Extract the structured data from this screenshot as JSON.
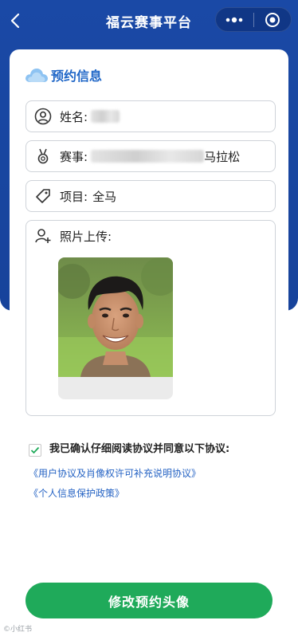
{
  "nav": {
    "title": "福云赛事平台"
  },
  "section": {
    "title": "预约信息"
  },
  "fields": [
    {
      "label": "姓名:",
      "value": ""
    },
    {
      "label": "赛事:",
      "value_suffix": "马拉松"
    },
    {
      "label": "项目:",
      "value": "全马"
    }
  ],
  "photo": {
    "label": "照片上传:"
  },
  "agreement": {
    "checked": true,
    "text": "我已确认仔细阅读协议并同意以下协议:",
    "links": [
      "《用户协议及肖像权许可补充说明协议》",
      "《个人信息保护政策》"
    ]
  },
  "submit": {
    "label": "修改预约头像"
  },
  "watermark": "©小红书",
  "colors": {
    "primary_blue": "#1a49a6",
    "accent_green": "#1faa5a",
    "link_blue": "#2563c4"
  }
}
